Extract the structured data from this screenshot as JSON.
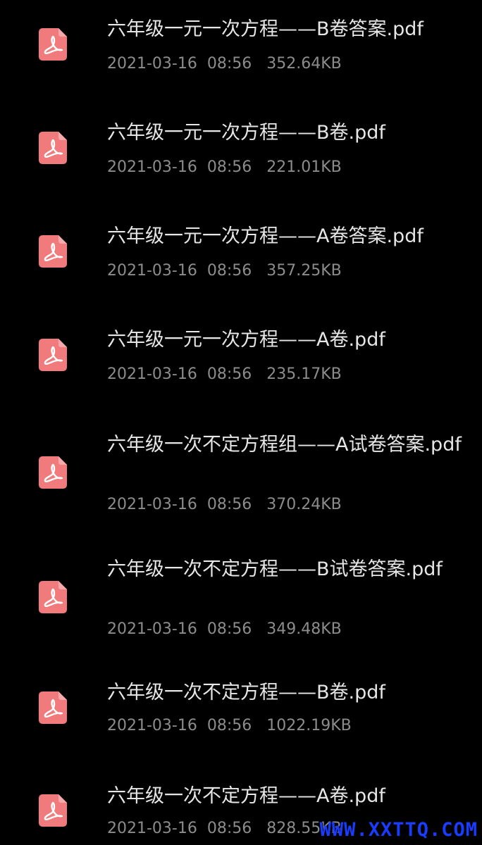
{
  "colors": {
    "background": "#000000",
    "file_name": "#e6e6e6",
    "file_meta": "#8c8c8c",
    "pdf_icon": "#f07a7c",
    "watermark": "#1a3cff"
  },
  "icons": {
    "file_type": "pdf-file-icon"
  },
  "files": [
    {
      "name": "六年级一元一次方程——B卷答案.pdf",
      "meta": "2021-03-16  08:56   352.64KB"
    },
    {
      "name": "六年级一元一次方程——B卷.pdf",
      "meta": "2021-03-16  08:56   221.01KB"
    },
    {
      "name": "六年级一元一次方程——A卷答案.pdf",
      "meta": "2021-03-16  08:56   357.25KB"
    },
    {
      "name": "六年级一元一次方程——A卷.pdf",
      "meta": "2021-03-16  08:56   235.17KB"
    },
    {
      "name": "六年级一次不定方程组——A试卷答案.pdf",
      "meta": "2021-03-16  08:56   370.24KB"
    },
    {
      "name": "六年级一次不定方程——B试卷答案.pdf",
      "meta": "2021-03-16  08:56   349.48KB"
    },
    {
      "name": "六年级一次不定方程——B卷.pdf",
      "meta": "2021-03-16  08:56   1022.19KB"
    },
    {
      "name": "六年级一次不定方程——A卷.pdf",
      "meta": "2021-03-16  08:56   828.55KB"
    }
  ],
  "watermark": "WWW.XXTTQ.COM"
}
